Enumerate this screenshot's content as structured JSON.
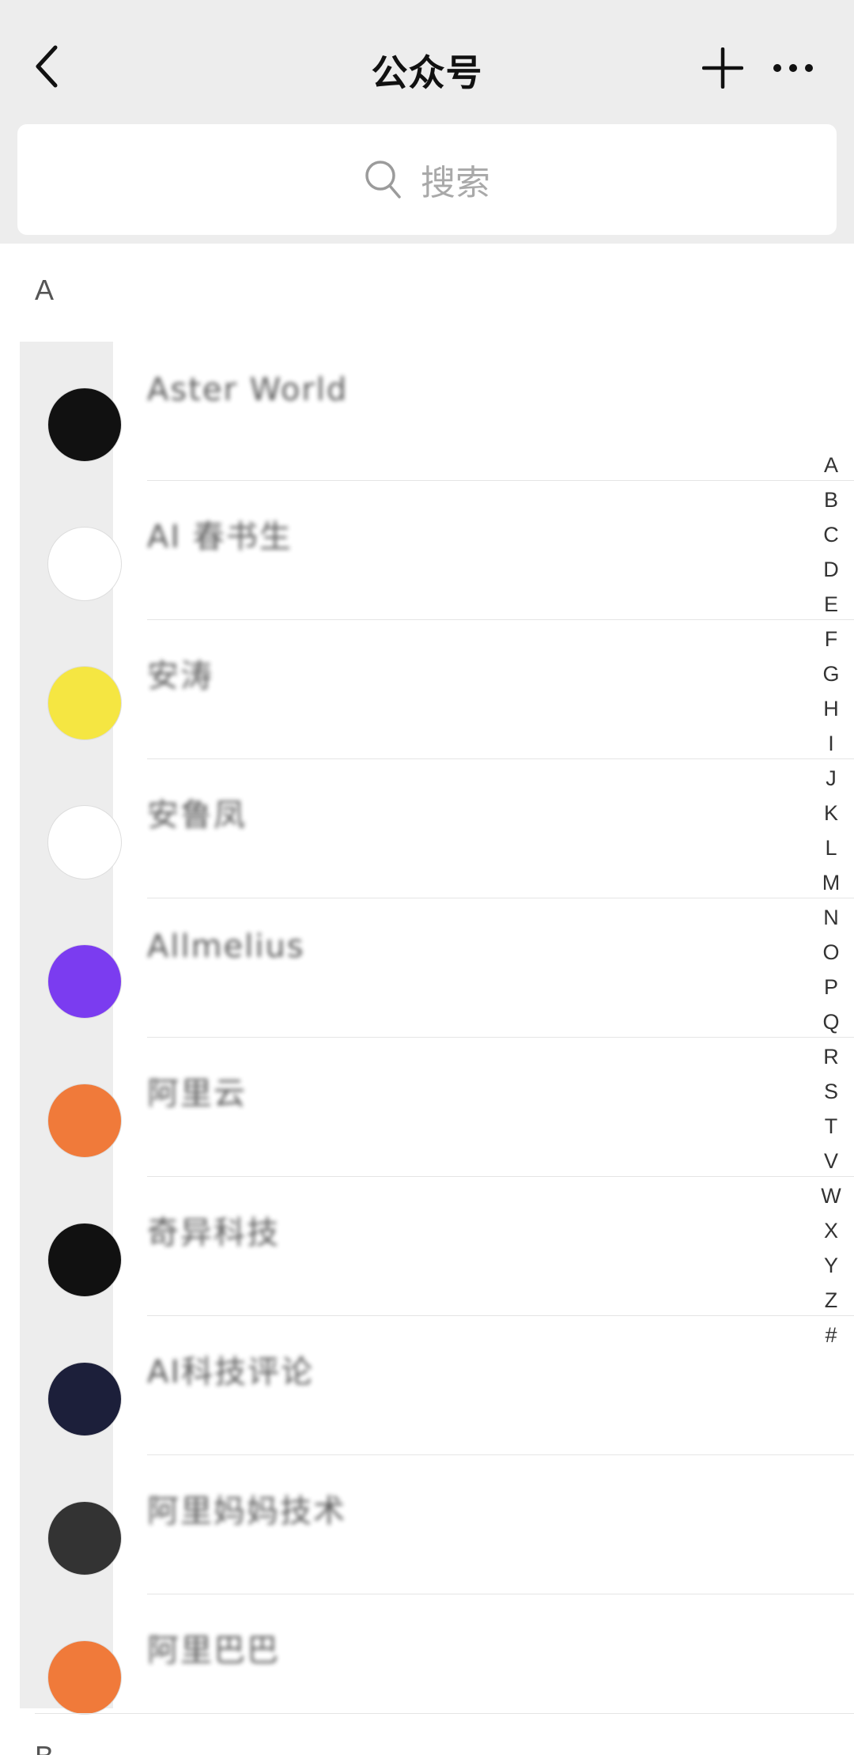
{
  "header": {
    "title": "公众号",
    "back_icon": "chevron-left-icon",
    "add_icon": "plus-icon",
    "more_icon": "more-horizontal-icon"
  },
  "search": {
    "placeholder": "搜索",
    "icon": "search-icon"
  },
  "sections": {
    "a": "A",
    "b": "B"
  },
  "accounts": [
    {
      "name": "Aster World",
      "avatar_color": "#111111"
    },
    {
      "name": "AI 春书生",
      "avatar_color": "#ffffff"
    },
    {
      "name": "安涛",
      "avatar_color": "#f5e642"
    },
    {
      "name": "安鲁凤",
      "avatar_color": "#ffffff"
    },
    {
      "name": "Allmelius",
      "avatar_color": "#7b3cf0"
    },
    {
      "name": "阿里云",
      "avatar_color": "#f07a3a"
    },
    {
      "name": "奇异科技",
      "avatar_color": "#111111"
    },
    {
      "name": "AI科技评论",
      "avatar_color": "#1c1f3a"
    },
    {
      "name": "阿里妈妈技术",
      "avatar_color": "#333333"
    },
    {
      "name": "阿里巴巴",
      "avatar_color": "#f07a3a"
    }
  ],
  "alphabet_index": [
    "A",
    "B",
    "C",
    "D",
    "E",
    "F",
    "G",
    "H",
    "I",
    "J",
    "K",
    "L",
    "M",
    "N",
    "O",
    "P",
    "Q",
    "R",
    "S",
    "T",
    "V",
    "W",
    "X",
    "Y",
    "Z",
    "#"
  ],
  "colors": {
    "background": "#ededed",
    "list_bg": "#ffffff",
    "divider": "#e5e5e5"
  }
}
